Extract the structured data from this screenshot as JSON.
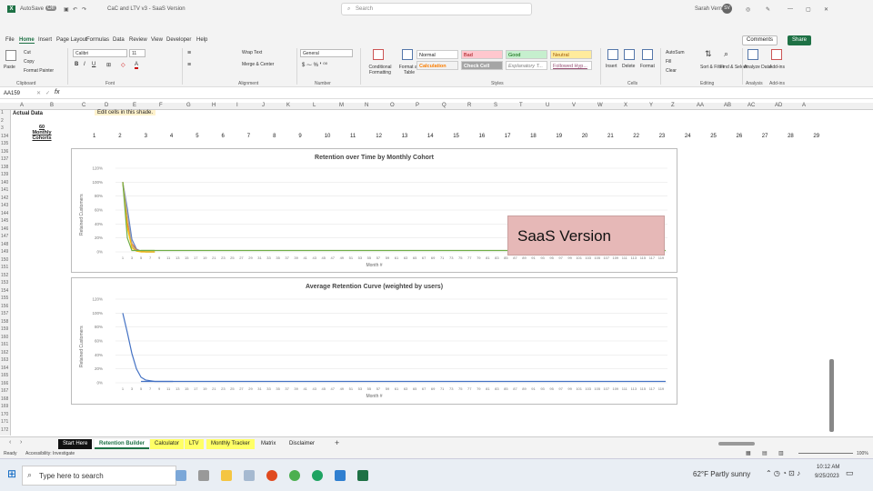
{
  "titlebar": {
    "autosave": "AutoSave",
    "autosave_state": "Off",
    "filename": "CaC and LTV v3 - SaaS Version",
    "search_placeholder": "Search",
    "user": "Sarah Vernon",
    "user_initials": "SV"
  },
  "menu": [
    "File",
    "Home",
    "Insert",
    "Page Layout",
    "Formulas",
    "Data",
    "Review",
    "View",
    "Developer",
    "Help"
  ],
  "menu_active": "Home",
  "comments_label": "Comments",
  "share_label": "Share",
  "ribbon": {
    "paste": "Paste",
    "cut": "Cut",
    "copy": "Copy",
    "format_painter": "Format Painter",
    "clipboard": "Clipboard",
    "font_name": "Calibri",
    "font_size": "11",
    "font_group": "Font",
    "wrap_text": "Wrap Text",
    "merge_center": "Merge & Center",
    "alignment": "Alignment",
    "number_format": "General",
    "number": "Number",
    "conditional": "Conditional Formatting",
    "format_table": "Format as Table",
    "styles_group": "Styles",
    "style_normal": "Normal",
    "style_bad": "Bad",
    "style_good": "Good",
    "style_neutral": "Neutral",
    "style_calculation": "Calculation",
    "style_check": "Check Cell",
    "style_explanatory": "Explanatory T...",
    "style_followed": "Followed Hyp...",
    "insert": "Insert",
    "delete": "Delete",
    "format": "Format",
    "cells": "Cells",
    "autosum": "AutoSum",
    "fill": "Fill",
    "clear": "Clear",
    "sort_filter": "Sort & Filter",
    "find_select": "Find & Select",
    "editing": "Editing",
    "analyze": "Analyze Data",
    "analysis": "Analysis",
    "addins": "Add-ins"
  },
  "formula_bar": {
    "name_box": "AA159",
    "fx": "fx",
    "value": ""
  },
  "columns": [
    "A",
    "B",
    "C",
    "D",
    "E",
    "F",
    "G",
    "H",
    "I",
    "J",
    "K",
    "L",
    "M",
    "N",
    "O",
    "P",
    "Q",
    "R",
    "S",
    "T",
    "U",
    "V",
    "W",
    "X",
    "Y",
    "Z",
    "AA",
    "AB",
    "AC",
    "AD",
    "A"
  ],
  "rows": [
    "1",
    "2",
    "3",
    "134",
    "135",
    "136",
    "137",
    "138",
    "139",
    "140",
    "141",
    "142",
    "143",
    "144",
    "145",
    "146",
    "147",
    "148",
    "149",
    "150",
    "151",
    "152",
    "153",
    "154",
    "155",
    "156",
    "157",
    "158",
    "159",
    "160",
    "161",
    "162",
    "163",
    "164",
    "165",
    "166",
    "167",
    "168",
    "169",
    "170",
    "171",
    "172"
  ],
  "cells": {
    "a1": "Actual Data",
    "c1": "Edit cells in this shade.",
    "a3": "60 Monthly Cohorts",
    "cohort_numbers": [
      "1",
      "2",
      "3",
      "4",
      "5",
      "6",
      "7",
      "8",
      "9",
      "10",
      "11",
      "12",
      "13",
      "14",
      "15",
      "16",
      "17",
      "18",
      "19",
      "20",
      "21",
      "22",
      "23",
      "24",
      "25",
      "26",
      "27",
      "28",
      "29"
    ]
  },
  "chart_data": [
    {
      "type": "line",
      "title": "Retention over Time by Monthly Cohort",
      "xlabel": "Month #",
      "ylabel": "Retained Customers",
      "ylim": [
        0,
        1.2
      ],
      "yticks": [
        "0%",
        "20%",
        "40%",
        "60%",
        "80%",
        "100%",
        "120%"
      ],
      "xticks": [
        "1",
        "3",
        "5",
        "7",
        "9",
        "11",
        "13",
        "15",
        "17",
        "19",
        "21",
        "23",
        "25",
        "27",
        "29",
        "31",
        "33",
        "35",
        "37",
        "39",
        "41",
        "43",
        "45",
        "47",
        "49",
        "51",
        "53",
        "55",
        "57",
        "59",
        "61",
        "63",
        "65",
        "67",
        "69",
        "71",
        "73",
        "75",
        "77",
        "79",
        "81",
        "83",
        "85",
        "87",
        "89",
        "91",
        "93",
        "95",
        "97",
        "99",
        "101",
        "103",
        "105",
        "107",
        "109",
        "111",
        "113",
        "115",
        "117",
        "119"
      ],
      "series": [
        {
          "color": "#5b7fc7",
          "values": [
            1.0,
            0.62,
            0.18,
            0.04,
            0.01,
            0.0,
            0.0,
            0.0
          ]
        },
        {
          "color": "#ed7d31",
          "values": [
            1.0,
            0.42,
            0.12,
            0.03,
            0.01,
            0.0,
            0.0,
            0.0
          ]
        },
        {
          "color": "#a5a5a5",
          "values": [
            1.0,
            0.55,
            0.09,
            0.02,
            0.0,
            0.0,
            0.0,
            0.0
          ]
        },
        {
          "color": "#ffc000",
          "values": [
            1.0,
            0.35,
            0.06,
            0.01,
            0.0,
            0.0,
            0.0,
            0.0
          ]
        },
        {
          "color": "#70ad47",
          "values": [
            1.0,
            0.2,
            0.02,
            0.02,
            0.02,
            0.02,
            0.02,
            0.02
          ]
        }
      ],
      "tail_series_color": "#70ad47",
      "tail_value": 0.02
    },
    {
      "type": "line",
      "title": "Average Retention Curve (weighted by users)",
      "xlabel": "Month #",
      "ylabel": "Retained Customers",
      "ylim": [
        0,
        1.2
      ],
      "yticks": [
        "0%",
        "20%",
        "40%",
        "60%",
        "80%",
        "100%",
        "120%"
      ],
      "xticks": [
        "1",
        "3",
        "5",
        "7",
        "9",
        "11",
        "13",
        "15",
        "17",
        "19",
        "21",
        "23",
        "25",
        "27",
        "29",
        "31",
        "33",
        "35",
        "37",
        "39",
        "41",
        "43",
        "45",
        "47",
        "49",
        "51",
        "53",
        "55",
        "57",
        "59",
        "61",
        "63",
        "65",
        "67",
        "69",
        "71",
        "73",
        "75",
        "77",
        "79",
        "81",
        "83",
        "85",
        "87",
        "89",
        "91",
        "93",
        "95",
        "97",
        "99",
        "101",
        "103",
        "105",
        "107",
        "109",
        "111",
        "113",
        "115",
        "117",
        "119"
      ],
      "series": [
        {
          "color": "#4472c4",
          "values": [
            1.0,
            0.72,
            0.42,
            0.2,
            0.08,
            0.04,
            0.03,
            0.02,
            0.02,
            0.02,
            0.02,
            0.02
          ]
        }
      ],
      "tail_value": 0.02
    }
  ],
  "overlay_label": "SaaS Version",
  "sheet_tabs": [
    {
      "label": "Start Here",
      "style": "dark"
    },
    {
      "label": "Retention Builder",
      "style": "active"
    },
    {
      "label": "Calculator",
      "style": "yellow"
    },
    {
      "label": "LTV",
      "style": "yellow"
    },
    {
      "label": "Monthly Tracker",
      "style": "yellow"
    },
    {
      "label": "Matrix",
      "style": "plain"
    },
    {
      "label": "Disclaimer",
      "style": "plain"
    }
  ],
  "status": {
    "ready": "Ready",
    "accessibility": "Accessibility: Investigate",
    "zoom": "100%"
  },
  "taskbar": {
    "search_placeholder": "Type here to search",
    "weather": "62°F Partly sunny",
    "time": "10:12 AM",
    "date": "9/25/2023"
  }
}
